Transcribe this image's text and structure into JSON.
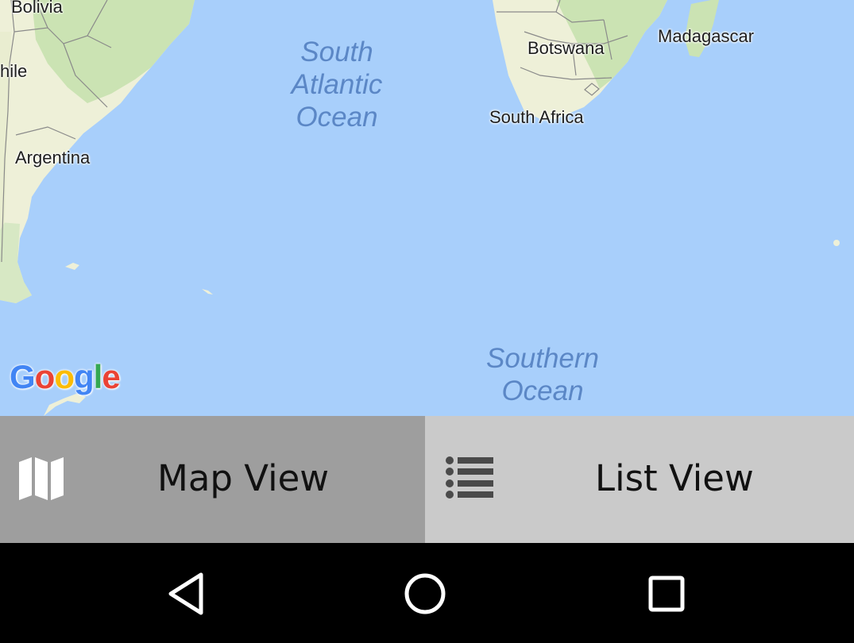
{
  "map": {
    "place_labels": {
      "bolivia": "Bolivia",
      "chile": "hile",
      "argentina": "Argentina",
      "botswana": "Botswana",
      "south_africa": "South Africa",
      "madagascar": "Madagascar"
    },
    "ocean_labels": {
      "south_atlantic_line1": "South",
      "south_atlantic_line2": "Atlantic",
      "south_atlantic_line3": "Ocean",
      "southern_line1": "Southern",
      "southern_line2": "Ocean"
    },
    "attribution": {
      "logo_letters": [
        "G",
        "o",
        "o",
        "g",
        "l",
        "e"
      ],
      "logo_colors": [
        "#4285f4",
        "#ea4335",
        "#fbbc05",
        "#4285f4",
        "#34a853",
        "#ea4335"
      ]
    },
    "colors": {
      "water": "#a8cffb",
      "land": "#eef0d8",
      "forest": "#cbe3b3",
      "border": "#8a8a8a"
    }
  },
  "toggle": {
    "map_view": {
      "label": "Map View",
      "icon": "map-icon",
      "selected": true
    },
    "list_view": {
      "label": "List View",
      "icon": "list-icon",
      "selected": false
    },
    "colors": {
      "map_bg": "#9e9e9e",
      "list_bg": "#cacaca"
    }
  },
  "navigation": {
    "back": {
      "icon": "back-triangle-icon"
    },
    "home": {
      "icon": "home-circle-icon"
    },
    "recents": {
      "icon": "recents-square-icon"
    }
  }
}
